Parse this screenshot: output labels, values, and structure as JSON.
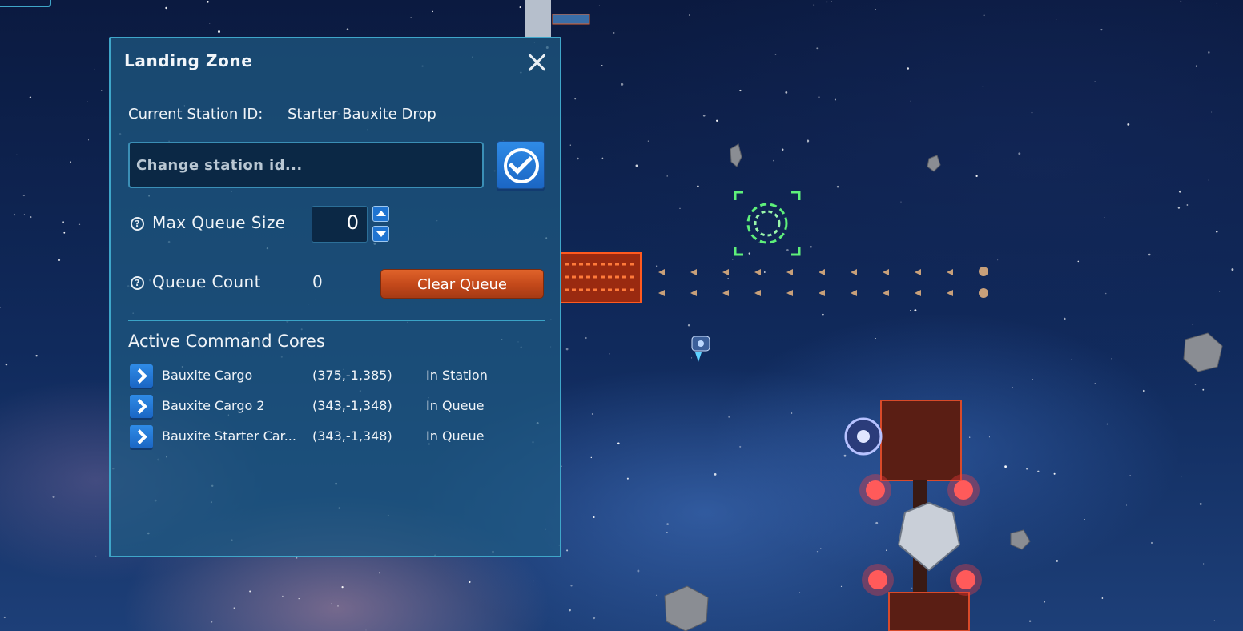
{
  "panel": {
    "title": "Landing Zone",
    "station_label": "Current Station ID:",
    "station_value": "Starter Bauxite Drop",
    "station_input_placeholder": "Change station id...",
    "max_queue_label": "Max Queue Size",
    "max_queue_value": "0",
    "queue_count_label": "Queue Count",
    "queue_count_value": "0",
    "clear_queue_label": "Clear Queue",
    "help_glyph": "?",
    "cores_title": "Active Command Cores",
    "cores": [
      {
        "name": "Bauxite Cargo",
        "coords": "(375,-1,385)",
        "status": "In Station"
      },
      {
        "name": "Bauxite Cargo 2",
        "coords": "(343,-1,348)",
        "status": "In Queue"
      },
      {
        "name": "Bauxite Starter Car...",
        "coords": "(343,-1,348)",
        "status": "In Queue"
      }
    ]
  },
  "colors": {
    "panel_border": "#3fa6c9",
    "accent_blue": "#1f74d1",
    "clear_button": "#c2481a",
    "target_marker": "#5ef07a"
  }
}
